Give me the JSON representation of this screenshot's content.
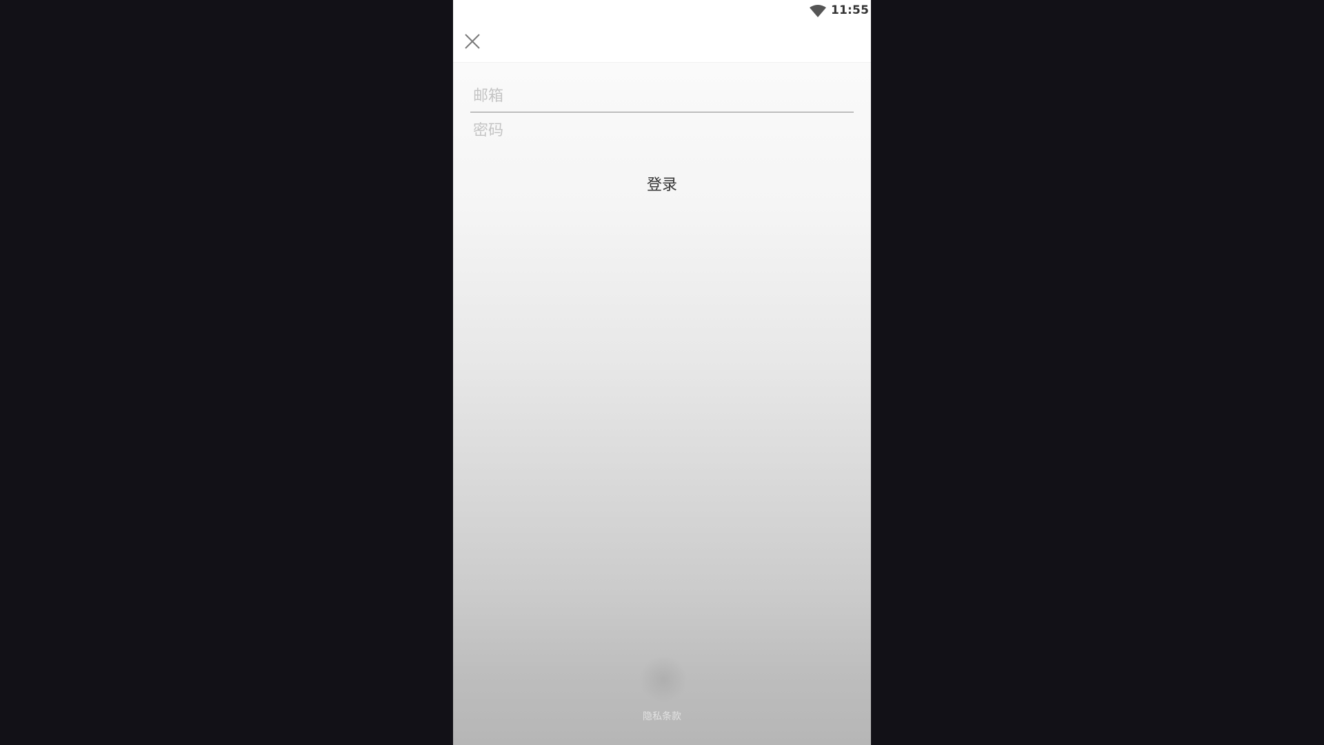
{
  "status_bar": {
    "time": "11:55",
    "wifi_icon": "wifi-icon"
  },
  "toolbar": {
    "close_icon": "close-icon"
  },
  "login_form": {
    "email_placeholder": "邮箱",
    "email_value": "",
    "password_placeholder": "密码",
    "password_value": "",
    "login_label": "登录"
  },
  "footer": {
    "privacy_label": "隐私条款"
  },
  "colors": {
    "backdrop": "#121117",
    "text_primary": "#333333",
    "placeholder": "#c4c4c4",
    "divider": "#8a8a8a"
  }
}
